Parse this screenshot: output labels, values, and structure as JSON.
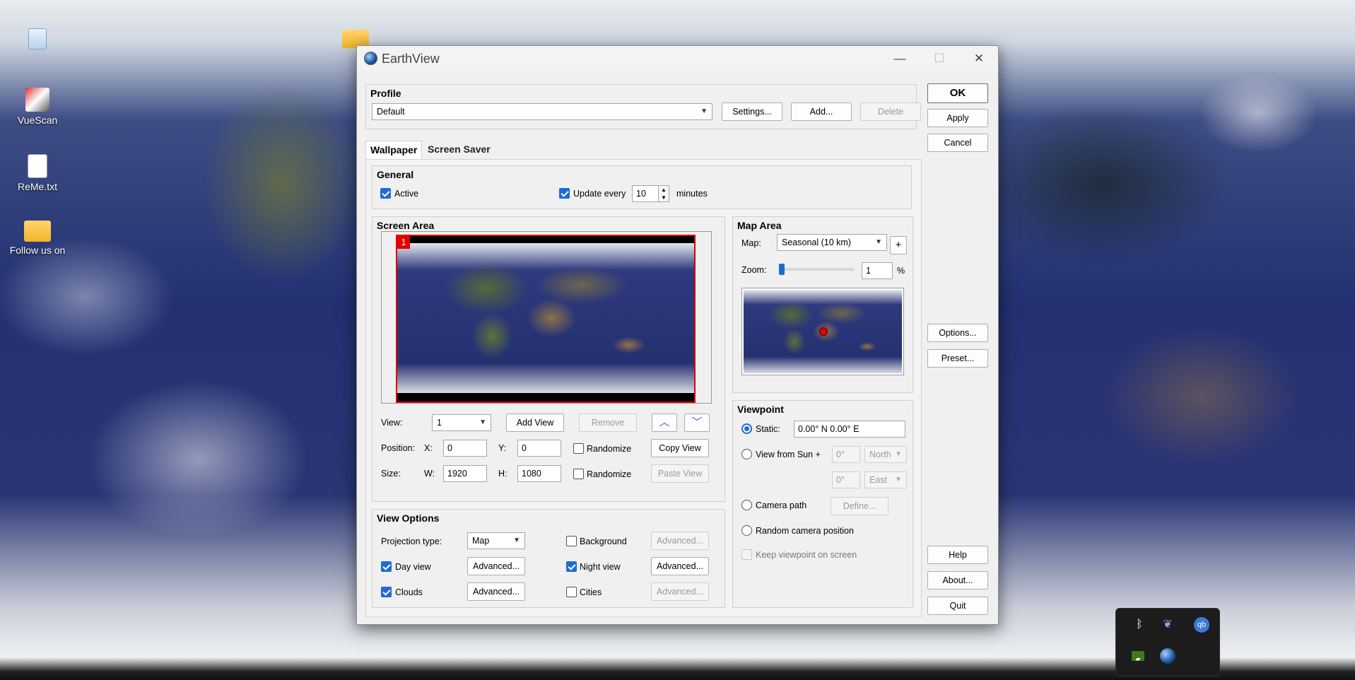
{
  "desktop": {
    "icons": [
      {
        "label": ""
      },
      {
        "label": "VueScan"
      },
      {
        "label": "ReMe.txt"
      },
      {
        "label": "Follow us on"
      }
    ]
  },
  "window": {
    "title": "EarthView",
    "minimize": "—",
    "maximize": "☐",
    "close": "✕"
  },
  "profile": {
    "title": "Profile",
    "selected": "Default",
    "settings": "Settings...",
    "add": "Add...",
    "delete": "Delete"
  },
  "side_buttons": {
    "ok": "OK",
    "apply": "Apply",
    "cancel": "Cancel",
    "options": "Options...",
    "preset": "Preset...",
    "help": "Help",
    "about": "About...",
    "quit": "Quit"
  },
  "tabs": [
    {
      "label": "Wallpaper"
    },
    {
      "label": "Screen Saver"
    }
  ],
  "general": {
    "title": "General",
    "active": "Active",
    "update_every": "Update every",
    "interval": "10",
    "minutes": "minutes"
  },
  "screen_area": {
    "title": "Screen Area",
    "monitor_badge": "1",
    "view_label": "View:",
    "view_value": "1",
    "add_view": "Add View",
    "remove": "Remove",
    "position_label": "Position:",
    "x_label": "X:",
    "x_value": "0",
    "y_label": "Y:",
    "y_value": "0",
    "randomize": "Randomize",
    "copy_view": "Copy View",
    "size_label": "Size:",
    "w_label": "W:",
    "w_value": "1920",
    "h_label": "H:",
    "h_value": "1080",
    "paste_view": "Paste View"
  },
  "view_options": {
    "title": "View Options",
    "projection_label": "Projection type:",
    "projection_value": "Map",
    "background": "Background",
    "day_view": "Day view",
    "night_view": "Night view",
    "clouds": "Clouds",
    "cities": "Cities",
    "advanced": "Advanced..."
  },
  "map_area": {
    "title": "Map Area",
    "map_label": "Map:",
    "map_value": "Seasonal (10 km)",
    "plus": "+",
    "zoom_label": "Zoom:",
    "zoom_value": "1",
    "zoom_percent": 1,
    "percent": "%"
  },
  "viewpoint": {
    "title": "Viewpoint",
    "static": "Static:",
    "static_value": "0.00° N   0.00° E",
    "view_from_sun": "View from Sun +",
    "deg1": "0°",
    "north": "North",
    "deg2": "0°",
    "east": "East",
    "camera_path": "Camera path",
    "define": "Define...",
    "random_camera": "Random camera position",
    "keep_viewpoint": "Keep viewpoint on screen"
  },
  "tray": {
    "icons": [
      "bluetooth-icon",
      "feather-icon",
      "qbittorrent-icon",
      "nvidia-icon",
      "earthview-icon"
    ],
    "qb": "qb",
    "bt": "ᛒ"
  },
  "colors": {
    "accent": "#1f6bd1",
    "monitor_border": "#e00000"
  }
}
